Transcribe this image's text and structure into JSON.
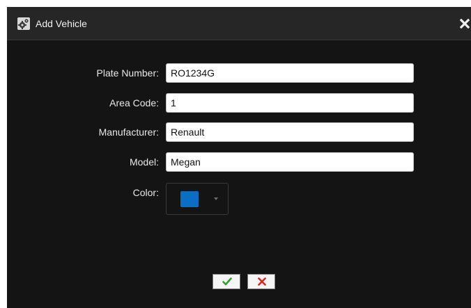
{
  "dialog": {
    "title": "Add Vehicle",
    "title_icon": "gears-icon",
    "close_icon": "close-icon"
  },
  "form": {
    "plate_number": {
      "label": "Plate Number:",
      "value": "RO1234G"
    },
    "area_code": {
      "label": "Area Code:",
      "value": "1"
    },
    "manufacturer": {
      "label": "Manufacturer:",
      "value": "Renault"
    },
    "model": {
      "label": "Model:",
      "value": "Megan"
    },
    "color": {
      "label": "Color:",
      "value": "#0a6fc4"
    }
  },
  "footer": {
    "confirm_icon": "checkmark-icon",
    "confirm_color": "#2fa12f",
    "cancel_icon": "close-icon",
    "cancel_color": "#e0241b"
  }
}
